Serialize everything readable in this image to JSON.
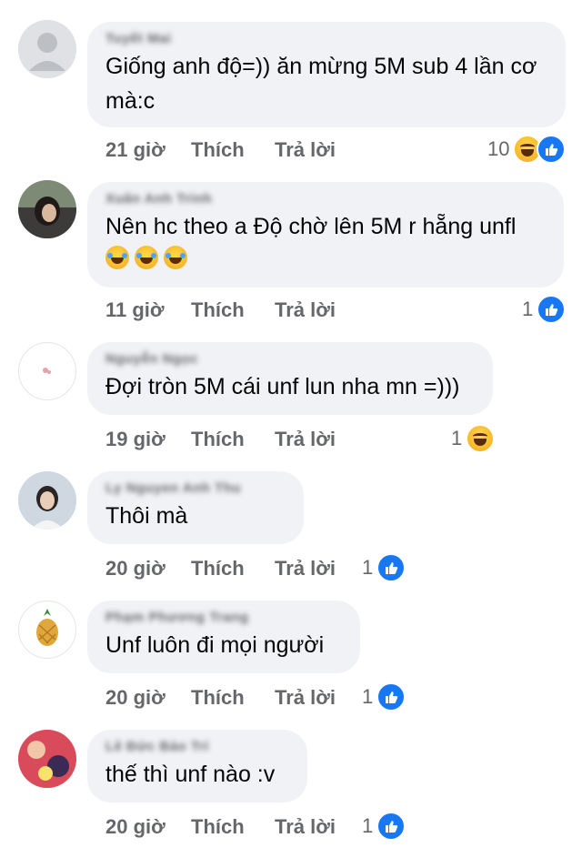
{
  "comments": [
    {
      "author": "Tuyết Mai",
      "text": "Giống anh độ=)) ăn mừng 5M sub 4 lần cơ mà:c",
      "time": "21 giờ",
      "like_label": "Thích",
      "reply_label": "Trả lời",
      "reaction_count": "10",
      "reactions": [
        "haha-icon",
        "like-icon"
      ]
    },
    {
      "author": "Xuân Anh Trinh",
      "text": "Nên hc theo a Độ chờ lên 5M r hẵng unfl",
      "emoji_line": [
        "laugh-cry-icon",
        "laugh-cry-icon",
        "laugh-cry-icon"
      ],
      "time": "11 giờ",
      "like_label": "Thích",
      "reply_label": "Trả lời",
      "reaction_count": "1",
      "reactions": [
        "like-icon"
      ]
    },
    {
      "author": "Nguyễn Ngọc",
      "text": "Đợi tròn 5M cái unf lun nha mn =)))",
      "time": "19 giờ",
      "like_label": "Thích",
      "reply_label": "Trả lời",
      "reaction_count": "1",
      "reactions": [
        "haha-icon"
      ]
    },
    {
      "author": "Ly Nguyen Anh Thu",
      "text": "Thôi mà",
      "time": "20 giờ",
      "like_label": "Thích",
      "reply_label": "Trả lời",
      "reaction_count": "1",
      "reactions": [
        "like-icon"
      ]
    },
    {
      "author": "Phạm Phương Trang",
      "text": "Unf luôn đi mọi người",
      "time": "20 giờ",
      "like_label": "Thích",
      "reply_label": "Trả lời",
      "reaction_count": "1",
      "reactions": [
        "like-icon"
      ]
    },
    {
      "author": "Lê Đức Bảo Trí",
      "text": "thế thì unf nào :v",
      "time": "20 giờ",
      "like_label": "Thích",
      "reply_label": "Trả lời",
      "reaction_count": "1",
      "reactions": [
        "like-icon"
      ]
    }
  ],
  "colors": {
    "bubble": "#f0f2f5",
    "meta_text": "#65676b",
    "like_blue": "#1877f2",
    "haha_yellow": "#f7b125"
  }
}
